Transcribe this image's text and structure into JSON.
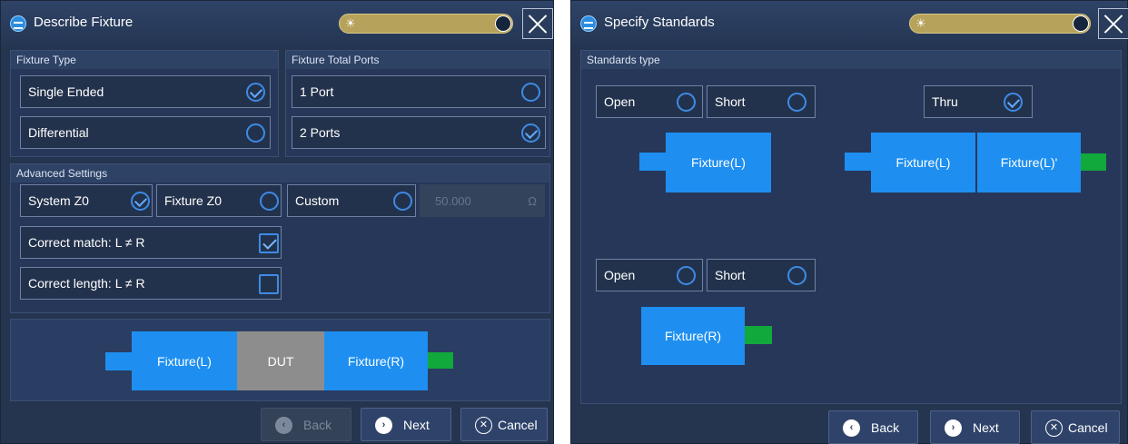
{
  "describe_fixture": {
    "title": "Describe Fixture",
    "fixture_type": {
      "label": "Fixture Type",
      "options": [
        {
          "label": "Single Ended",
          "selected": true
        },
        {
          "label": "Differential",
          "selected": false
        }
      ]
    },
    "fixture_total_ports": {
      "label": "Fixture Total Ports",
      "options": [
        {
          "label": "1 Port",
          "selected": false
        },
        {
          "label": "2 Ports",
          "selected": true
        }
      ]
    },
    "advanced": {
      "label": "Advanced Settings",
      "z0_options": [
        {
          "label": "System Z0",
          "selected": true
        },
        {
          "label": "Fixture Z0",
          "selected": false
        },
        {
          "label": "Custom",
          "selected": false
        }
      ],
      "custom_value": "50.000",
      "custom_unit": "Ω",
      "correct_match": {
        "label": "Correct match: L ≠ R",
        "checked": true
      },
      "correct_length": {
        "label": "Correct length: L ≠ R",
        "checked": false
      }
    },
    "diagram": {
      "fixture_left": "Fixture(L)",
      "dut": "DUT",
      "fixture_right": "Fixture(R)"
    },
    "buttons": {
      "back": "Back",
      "next": "Next",
      "cancel": "Cancel"
    }
  },
  "specify_standards": {
    "title": "Specify Standards",
    "group_label": "Standards type",
    "left_row": [
      {
        "label": "Open",
        "selected": false
      },
      {
        "label": "Short",
        "selected": false
      }
    ],
    "thru": {
      "label": "Thru",
      "selected": true
    },
    "right_row": [
      {
        "label": "Open",
        "selected": false
      },
      {
        "label": "Short",
        "selected": false
      }
    ],
    "fixture_left": "Fixture(L)",
    "thru_left": "Fixture(L)",
    "thru_right": "Fixture(L)'",
    "fixture_right": "Fixture(R)",
    "buttons": {
      "back": "Back",
      "next": "Next",
      "cancel": "Cancel"
    }
  },
  "icons": {
    "back": "chevron-left-icon",
    "next": "chevron-right-icon",
    "cancel": "close-circle-icon"
  },
  "colors": {
    "fixture": "#1e8ff0",
    "port": "#11a83c",
    "dut": "#8d8d8d",
    "toggle": "#b6a25a",
    "accent": "#3d8be6"
  }
}
